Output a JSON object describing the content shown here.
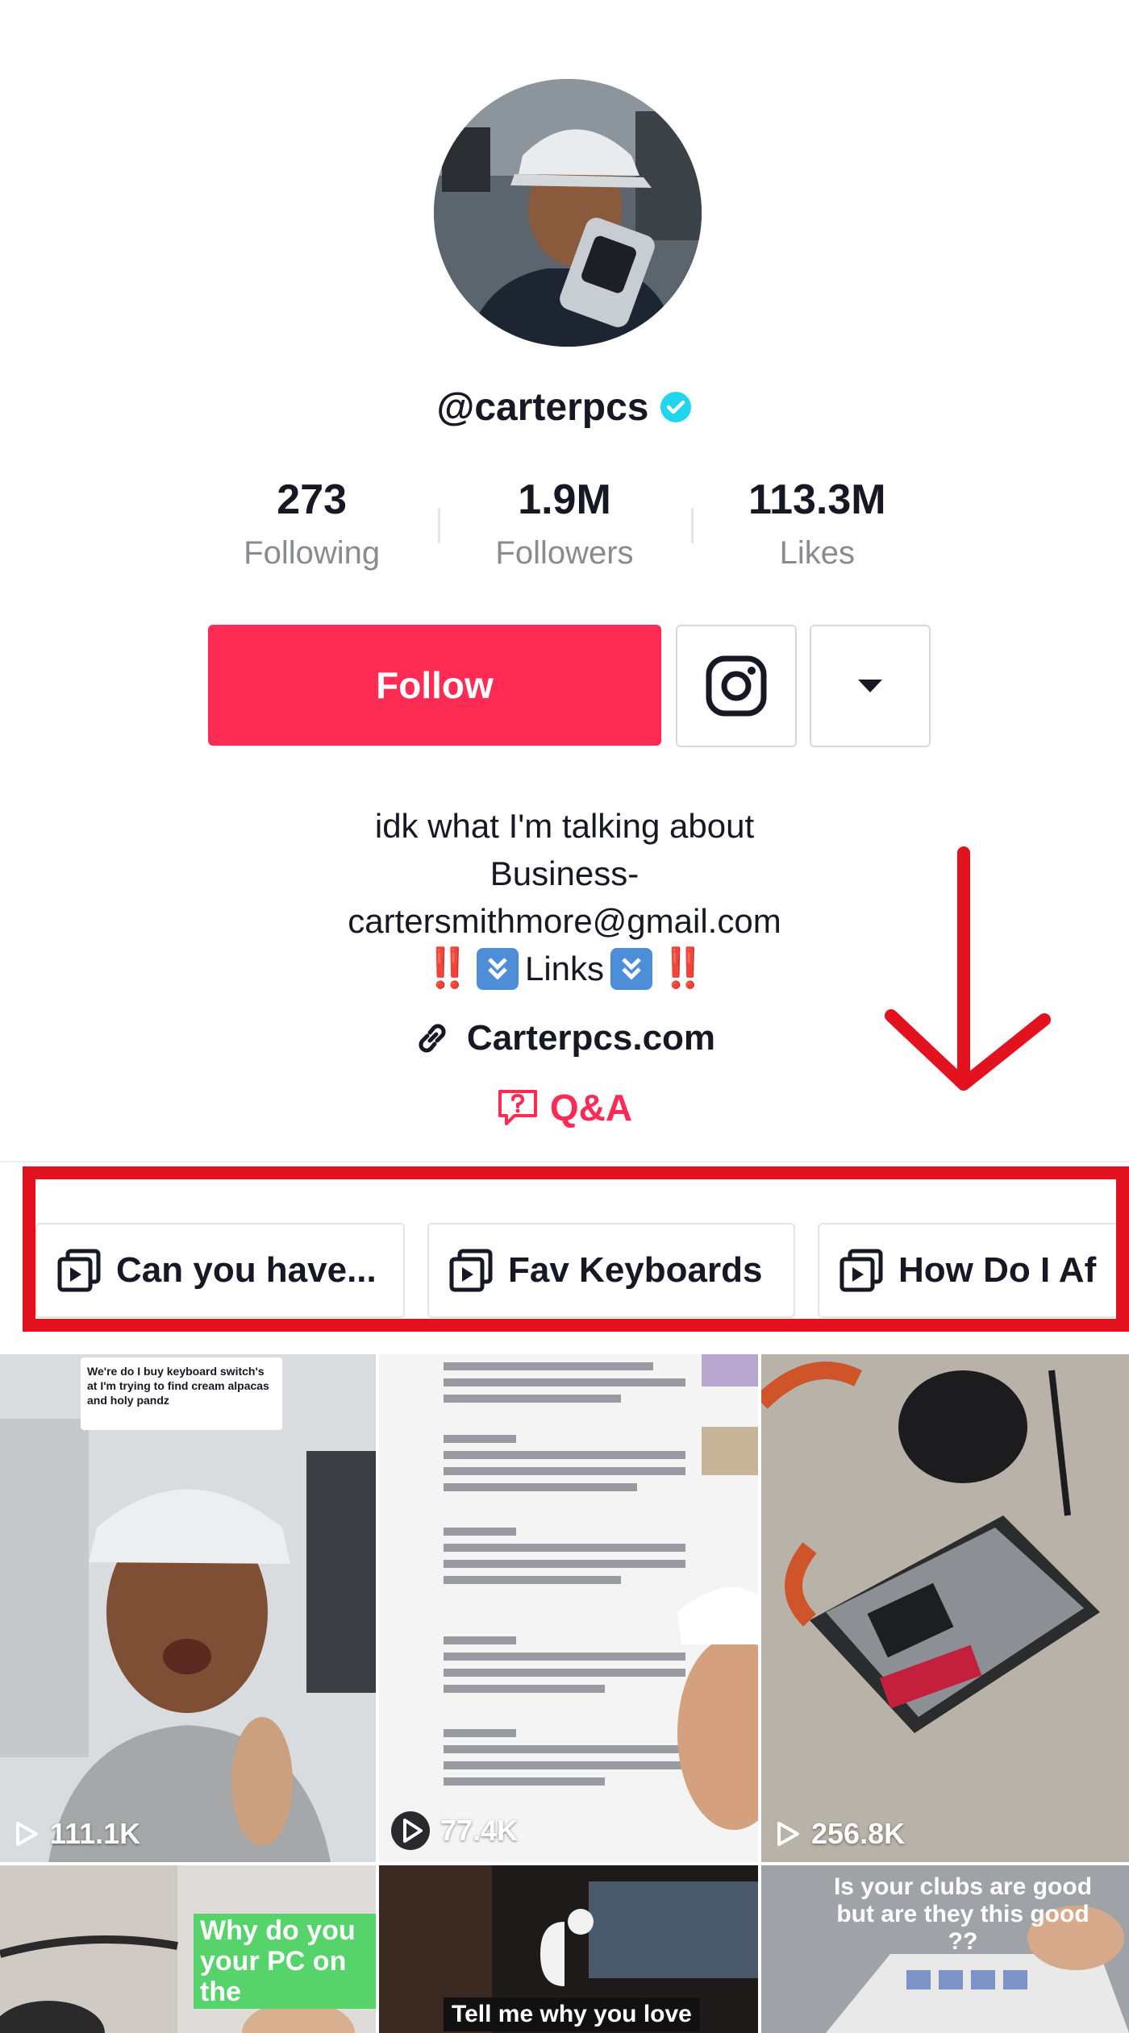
{
  "profile": {
    "handle": "@carterpcs",
    "verified": true,
    "stats": [
      {
        "value": "273",
        "label": "Following"
      },
      {
        "value": "1.9M",
        "label": "Followers"
      },
      {
        "value": "113.3M",
        "label": "Likes"
      }
    ],
    "follow_label": "Follow",
    "bio_lines": [
      "idk what I'm talking about",
      "Business-",
      "cartersmithmore@gmail.com"
    ],
    "bio_links_word": "Links",
    "bio_marks": "‼️",
    "link_text": "Carterpcs.com",
    "qa_label": "Q&A"
  },
  "playlists": [
    {
      "label": "Can you have..."
    },
    {
      "label": "Fav Keyboards"
    },
    {
      "label": "How Do I Af"
    }
  ],
  "videos": [
    {
      "views": "111.1K",
      "overlay": "We're do I buy keyboard switch's at I'm trying to find cream alpacas and holy pandz"
    },
    {
      "views": "77.4K",
      "overlay": ""
    },
    {
      "views": "256.8K",
      "overlay": ""
    },
    {
      "views": "",
      "overlay": "Why do you your PC on the"
    },
    {
      "views": "",
      "overlay": "Tell me why you love"
    },
    {
      "views": "",
      "overlay": "Is your clubs are good but are they this good ??"
    }
  ],
  "colors": {
    "brand_red": "#fe2c55",
    "verified_blue": "#20d5ec",
    "annotation_red": "#e3121f"
  },
  "icons": {
    "verified": "verified-badge-icon",
    "instagram": "instagram-icon",
    "dropdown": "caret-down-icon",
    "link": "link-icon",
    "qa": "question-bubble-icon",
    "playlist": "playlist-icon",
    "play": "play-icon"
  }
}
